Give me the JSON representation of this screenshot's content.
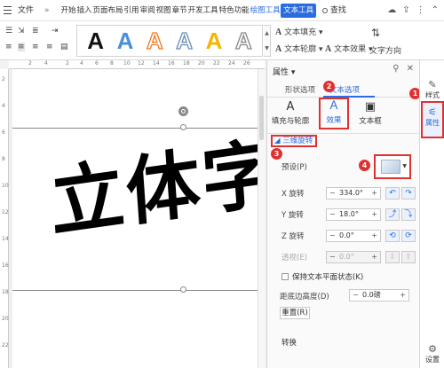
{
  "menubar": {
    "file_label": "文件",
    "chevron": "»",
    "tabs": [
      "开始",
      "插入",
      "页面布局",
      "引用",
      "审阅",
      "视图",
      "章节",
      "开发工具",
      "特色功能"
    ],
    "drawing_tool": "绘图工具",
    "text_tool": "文本工具",
    "search_label": "查找",
    "top_icons": [
      "cloud-icon",
      "share-icon",
      "more-icon",
      "collapse-icon"
    ]
  },
  "ribbon": {
    "gallery_letters": [
      "A",
      "A",
      "A",
      "A",
      "A",
      "A"
    ],
    "text_fill_label": "文本填充",
    "text_outline_label": "文本轮廓",
    "text_effect_label": "文本效果",
    "text_direction_label": "文字方向"
  },
  "ruler": {
    "h_ticks": [
      "2",
      "4",
      "2",
      "4",
      "6",
      "8",
      "10",
      "12",
      "14",
      "16",
      "18",
      "20",
      "22",
      "24",
      "26"
    ],
    "v_ticks": [
      "2",
      "4",
      "6",
      "8",
      "10",
      "12",
      "14",
      "16",
      "18",
      "20",
      "22"
    ]
  },
  "document": {
    "art_text": "立体字"
  },
  "panel": {
    "title": "属性 ▾",
    "tab_shape": "形状选项",
    "tab_text": "文本选项",
    "subtab_fill": "填充与轮廓",
    "subtab_effect": "效果",
    "subtab_frame": "文本框",
    "section_title": "◢ 三维旋转",
    "preset_label": "预设(P)",
    "x_label": "X 旋转",
    "x_value": "334.0°",
    "y_label": "Y 旋转",
    "y_value": "18.0°",
    "z_label": "Z 旋转",
    "z_value": "0.0°",
    "perspective_label": "透视(E)",
    "perspective_value": "0.0°",
    "keep_flat_label": "保持文本平面状态(K)",
    "distance_label": "距底边高度(D)",
    "distance_value": "0.0磅",
    "reset_label": "重置(R)",
    "transform_label": "转换"
  },
  "strip": {
    "style_label": "样式",
    "attr_label": "属性",
    "settings_label": "设置"
  },
  "badges": [
    "1",
    "2",
    "3",
    "4"
  ],
  "colors": {
    "accent": "#2b6de0",
    "highlight": "#e03131"
  }
}
